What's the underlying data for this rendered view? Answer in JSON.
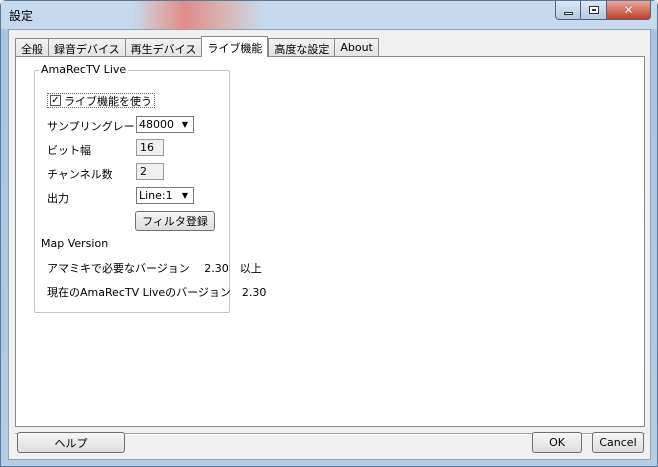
{
  "window": {
    "title": "設定"
  },
  "tabs": [
    {
      "label": "全般"
    },
    {
      "label": "録音デバイス"
    },
    {
      "label": "再生デバイス"
    },
    {
      "label": "ライブ機能"
    },
    {
      "label": "高度な設定"
    },
    {
      "label": "About"
    }
  ],
  "active_tab": "ライブ機能",
  "live_group": {
    "title": "AmaRecTV Live",
    "enable_checkbox": {
      "label": "ライブ機能を使う",
      "checked": true,
      "mark": "✓"
    },
    "sampling_rate": {
      "label": "サンプリングレート",
      "value": "48000"
    },
    "bit_depth": {
      "label": "ビット幅",
      "value": "16"
    },
    "channels": {
      "label": "チャンネル数",
      "value": "2"
    },
    "output": {
      "label": "出力",
      "value": "Line:1"
    },
    "filter_button": "フィルタ登録",
    "map_version": {
      "heading": "Map Version",
      "required_line": "アマミキで必要なバージョン　 2.30　以上",
      "current_line": "現在のAmaRecTV Liveのバージョン　2.30"
    }
  },
  "footer": {
    "help_button": "ヘルプ",
    "ok_button": "OK",
    "cancel_button": "Cancel"
  },
  "icons": {
    "minimize": "minimize-icon",
    "maximize": "maximize-icon",
    "close": "close-icon",
    "dropdown": "chevron-down-icon"
  }
}
